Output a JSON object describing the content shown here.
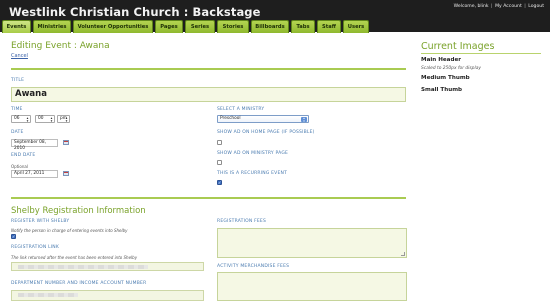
{
  "header": {
    "site_title": "Westlink Christian Church : Backstage",
    "welcome": "Welcome, blink",
    "my_account": "My Account",
    "logout": "Logout"
  },
  "nav": {
    "tabs": [
      {
        "label": "Events",
        "active": true
      },
      {
        "label": "Ministries",
        "active": false
      },
      {
        "label": "Volunteer Opportunities",
        "active": false
      },
      {
        "label": "Pages",
        "active": false
      },
      {
        "label": "Series",
        "active": false
      },
      {
        "label": "Stories",
        "active": false
      },
      {
        "label": "Billboards",
        "active": false
      },
      {
        "label": "Tabs",
        "active": false
      },
      {
        "label": "Staff",
        "active": false
      },
      {
        "label": "Users",
        "active": false
      }
    ]
  },
  "form": {
    "heading": "Editing Event : Awana",
    "cancel": "Cancel",
    "title_label": "Title",
    "title_value": "Awana",
    "time_label": "Time",
    "time_hour": "06",
    "time_minute": "00",
    "time_ampm": "pm",
    "date_label": "Date",
    "date_value": "September 08, 2010",
    "end_date_label": "End Date",
    "end_date_note": "Optional",
    "end_date_value": "April 27, 2011",
    "ministry_label": "Select a Ministry",
    "ministry_value": "Preschool",
    "show_home_label": "Show ad on home page (if possible)",
    "show_home_checked": false,
    "show_ministry_label": "Show ad on ministry page",
    "show_ministry_checked": false,
    "recurring_label": "This is a recurring event",
    "recurring_checked": true
  },
  "shelby": {
    "heading": "Shelby Registration Information",
    "register_label": "Register with Shelby",
    "register_note": "Notify the person in charge of entering events into Shelby",
    "register_checked": true,
    "link_label": "Registration Link",
    "link_note": "The link returned after the event has been entered into Shelby",
    "dept_label": "Department Number and Income Account Number",
    "fees_label": "Registration Fees",
    "merch_label": "Activity Merchandise Fees"
  },
  "sidebar": {
    "title": "Current Images",
    "main_header": "Main Header",
    "main_header_note": "Scaled to 250px for display",
    "medium_thumb": "Medium Thumb",
    "small_thumb": "Small Thumb"
  },
  "colors": {
    "header_bg": "#1e1e1e",
    "tab_green": "#9ec43c",
    "heading_green": "#7aa22a",
    "label_blue": "#4a7bb0",
    "field_bg": "#f5f8e4"
  }
}
